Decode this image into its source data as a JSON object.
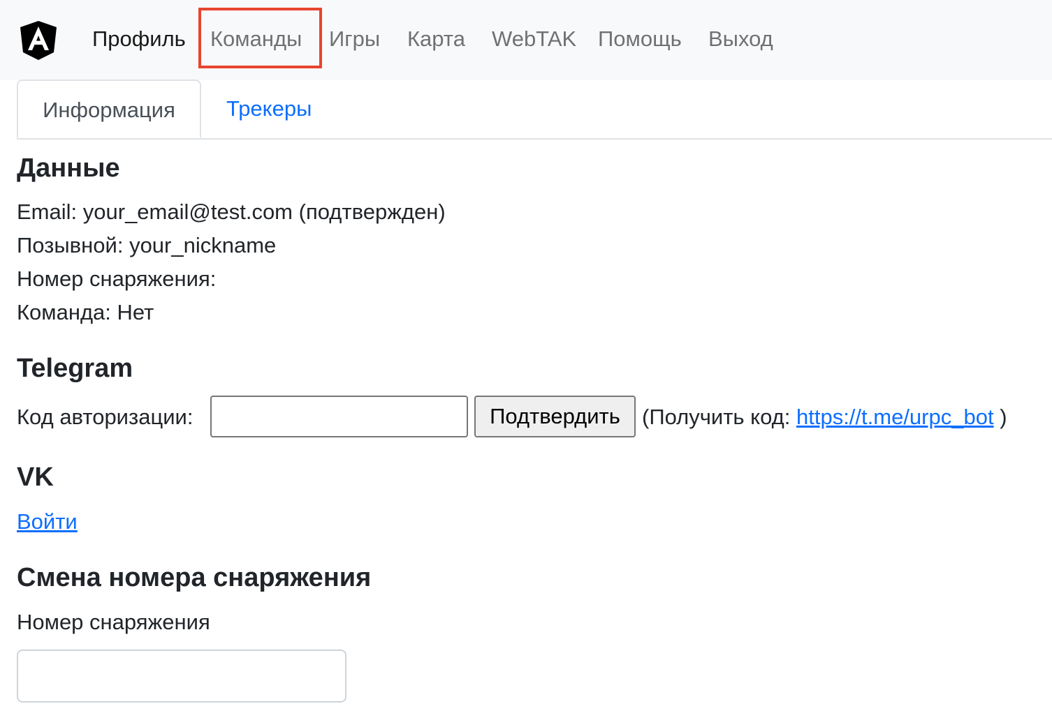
{
  "nav": {
    "logo_icon": "angular-logo-icon",
    "items": [
      {
        "label": "Профиль",
        "active": true
      },
      {
        "label": "Команды",
        "highlighted": true
      },
      {
        "label": "Игры"
      },
      {
        "label": "Карта"
      },
      {
        "label": "WebTAK"
      },
      {
        "label": "Помощь"
      },
      {
        "label": "Выход"
      }
    ],
    "highlight_color": "#e8442e"
  },
  "tabs": [
    {
      "label": "Информация",
      "active": true
    },
    {
      "label": "Трекеры",
      "active": false
    }
  ],
  "data_section": {
    "title": "Данные",
    "email_label": "Email:",
    "email_value": "your_email@test.com",
    "email_status": "(подтвержден)",
    "callsign_label": "Позывной:",
    "callsign_value": "your_nickname",
    "equipment_label": "Номер снаряжения:",
    "equipment_value": "",
    "team_label": "Команда:",
    "team_value": "Нет"
  },
  "telegram": {
    "title": "Telegram",
    "code_label": "Код авторизации:",
    "code_value": "",
    "confirm_label": "Подтвердить",
    "get_code_prefix": "(Получить код:",
    "bot_link": "https://t.me/urpc_bot",
    "get_code_suffix": ")"
  },
  "vk": {
    "title": "VK",
    "login_label": "Войти"
  },
  "equipment_change": {
    "title": "Смена номера снаряжения",
    "field_label": "Номер снаряжения",
    "field_value": ""
  },
  "colors": {
    "link": "#0d6efd",
    "navbar_bg": "#f8f9fa",
    "text": "#212529"
  }
}
